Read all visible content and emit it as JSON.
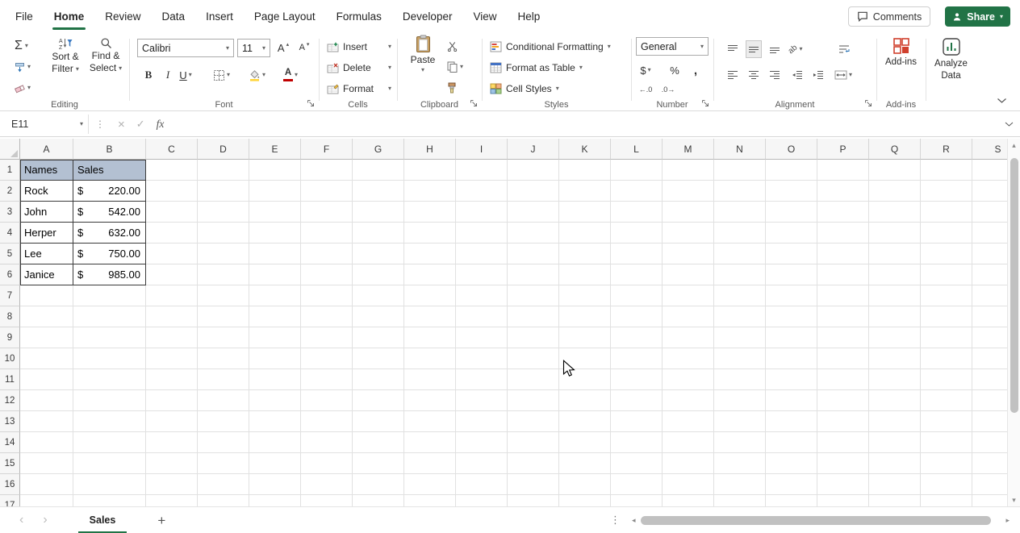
{
  "colors": {
    "accent": "#217346",
    "header_fill": "#B3C0D2",
    "grid_line": "#E1E1E1",
    "range_border": "#3B3B3B"
  },
  "menubar": {
    "tabs": [
      "File",
      "Home",
      "Review",
      "Data",
      "Insert",
      "Page Layout",
      "Formulas",
      "Developer",
      "View",
      "Help"
    ],
    "active_tab": "Home",
    "comments_label": "Comments",
    "share_label": "Share"
  },
  "ribbon": {
    "editing": {
      "label": "Editing",
      "sort1": "Sort &",
      "sort2": "Filter",
      "find1": "Find &",
      "find2": "Select"
    },
    "font": {
      "label": "Font",
      "name": "Calibri",
      "size": "11"
    },
    "cells": {
      "label": "Cells",
      "insert": "Insert",
      "delete": "Delete",
      "format": "Format"
    },
    "clipboard": {
      "label": "Clipboard",
      "paste": "Paste"
    },
    "styles": {
      "label": "Styles",
      "conditional": "Conditional Formatting",
      "format_table": "Format as Table",
      "cell_styles": "Cell Styles"
    },
    "number": {
      "label": "Number",
      "format": "General"
    },
    "alignment": {
      "label": "Alignment"
    },
    "addins": {
      "label": "Add-ins",
      "button": "Add-ins"
    },
    "analyze": {
      "line1": "Analyze",
      "line2": "Data"
    }
  },
  "formula_bar": {
    "name_box": "E11",
    "fx": "fx",
    "formula": ""
  },
  "sheet": {
    "columns": [
      "A",
      "B",
      "C",
      "D",
      "E",
      "F",
      "G",
      "H",
      "I",
      "J",
      "K",
      "L",
      "M",
      "N",
      "O",
      "P",
      "Q",
      "R",
      "S"
    ],
    "visible_rows": 17,
    "table": {
      "header": [
        "Names",
        "Sales"
      ],
      "rows": [
        [
          "Rock",
          "$",
          "220.00"
        ],
        [
          "John",
          "$",
          "542.00"
        ],
        [
          "Herper",
          "$",
          "632.00"
        ],
        [
          "Lee",
          "$",
          "750.00"
        ],
        [
          "Janice",
          "$",
          "985.00"
        ]
      ]
    }
  },
  "tabbar": {
    "sheet": "Sales",
    "add": "+"
  },
  "icons": {
    "caret": "▾",
    "caret_up": "▴",
    "autosum": "Σ",
    "bold": "B",
    "italic": "I",
    "underline": "U",
    "letter_a": "A",
    "cancel": "×",
    "check": "✓",
    "dots": "⋮",
    "currency": "$",
    "percent": "%",
    "comma": ",",
    "increase_decimal": "←.0",
    "decrease_decimal": ".0→",
    "orientation": "ab",
    "nav_left": "‹",
    "nav_right": "›",
    "scroll_left": "◂",
    "scroll_right": "▸",
    "scroll_up": "▴",
    "scroll_down": "▾",
    "ellipsis": "⋮"
  }
}
